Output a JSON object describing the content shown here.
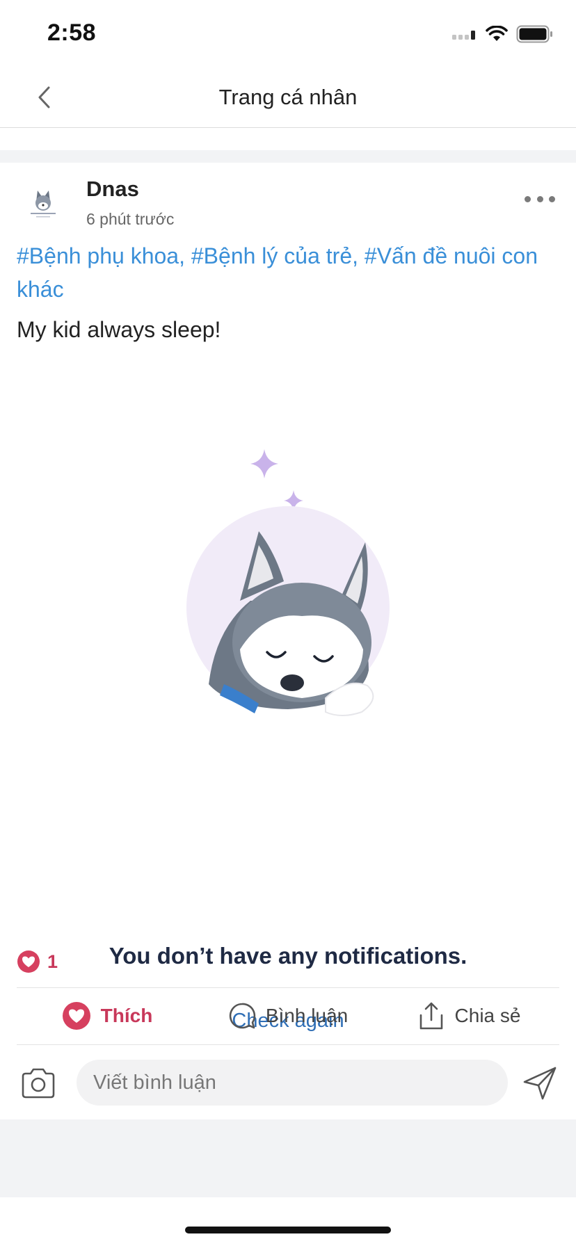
{
  "status_bar": {
    "time": "2:58",
    "icons": [
      "signal-icon",
      "wifi-icon",
      "battery-icon"
    ]
  },
  "nav": {
    "title": "Trang cá nhân",
    "back_icon": "chevron-left-icon"
  },
  "post": {
    "author": "Dnas",
    "time_ago": "6 phút trước",
    "hashtags": "#Bệnh phụ khoa, #Bệnh lý của trẻ, #Vấn đề nuôi con khác",
    "body": "My kid always sleep!",
    "image": {
      "illustration": "sleeping-husky-illustration",
      "title": "You don’t have any notifications.",
      "link": "Check again"
    },
    "reaction_count": "1"
  },
  "actions": {
    "like": "Thích",
    "comment": "Bình luận",
    "share": "Chia sẻ"
  },
  "comment_bar": {
    "placeholder": "Viết bình luận"
  },
  "colors": {
    "accent_blue": "#3a8fd8",
    "like_red": "#c8385a",
    "link_blue": "#2f6eb5",
    "illustration_lilac": "#c9b3ea"
  }
}
